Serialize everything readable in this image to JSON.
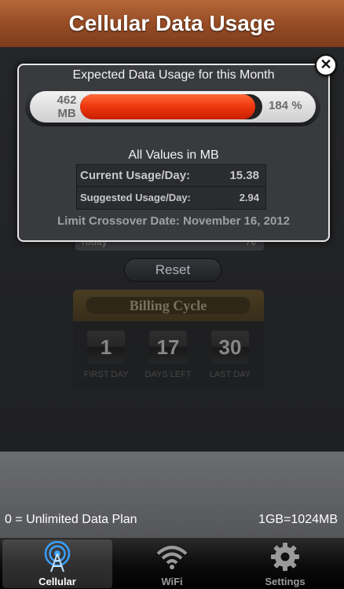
{
  "header": {
    "title": "Cellular Data Usage"
  },
  "background": {
    "partial_row_label": "Today",
    "partial_row_value": "70",
    "reset_label": "Reset",
    "billing": {
      "title": "Billing Cycle",
      "first_day": "1",
      "days_left": "17",
      "last_day": "30",
      "first_day_label": "FIRST DAY",
      "days_left_label": "DAYS LEFT",
      "last_day_label": "LAST DAY"
    }
  },
  "overlay": {
    "title": "Expected Data Usage for this Month",
    "gauge": {
      "amount_line1": "462",
      "amount_line2": "MB",
      "percent_text": "184 %",
      "fill_fraction": 0.96,
      "fill_color": "#f03a10"
    },
    "units_note": "All Values in MB",
    "stats": [
      {
        "label": "Current Usage/Day:",
        "value": "15.38"
      },
      {
        "label": "Suggested Usage/Day:",
        "value": "2.94"
      }
    ],
    "crossover": "Limit Crossover Date: November 16, 2012",
    "close_glyph": "✕"
  },
  "footer_notes": {
    "left": "0 = Unlimited Data Plan",
    "right": "1GB=1024MB"
  },
  "tabs": [
    {
      "label": "Cellular",
      "icon": "cellular-tower-icon",
      "active": true
    },
    {
      "label": "WiFi",
      "icon": "wifi-icon",
      "active": false
    },
    {
      "label": "Settings",
      "icon": "gear-icon",
      "active": false
    }
  ],
  "colors": {
    "header": "#9a4f27",
    "accent_blue": "#3aa0ff",
    "gauge_red": "#f03a10"
  }
}
